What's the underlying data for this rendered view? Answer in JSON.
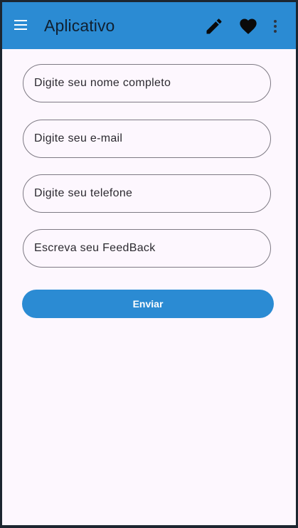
{
  "app_bar": {
    "title": "Aplicativo",
    "menu_icon": "hamburger-menu-icon",
    "actions": [
      "edit-pencil-icon",
      "favorite-heart-icon",
      "more-vert-icon"
    ],
    "background_color": "#2b8bd3"
  },
  "form": {
    "fields": [
      {
        "placeholder": "Digite seu nome completo"
      },
      {
        "placeholder": "Digite seu e-mail"
      },
      {
        "placeholder": "Digite seu telefone"
      },
      {
        "placeholder": "Escreva seu FeedBack"
      }
    ],
    "submit_label": "Enviar",
    "accent_color": "#2b8bd3"
  }
}
